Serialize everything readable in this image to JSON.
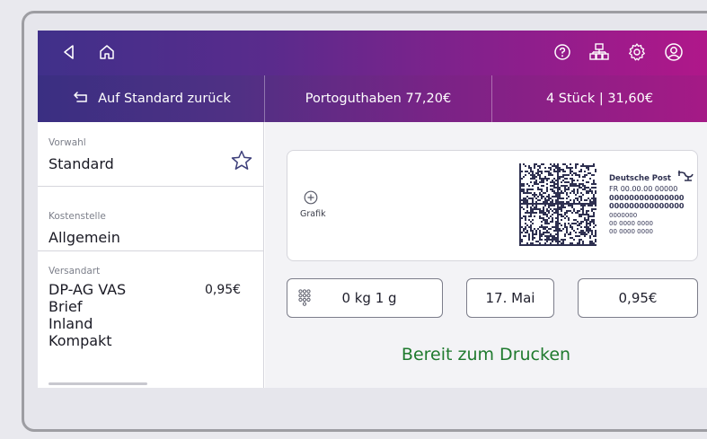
{
  "topbar": {
    "icons": [
      "back-triangle-icon",
      "home-icon",
      "help-icon",
      "network-icon",
      "settings-icon",
      "account-icon"
    ]
  },
  "subbar": {
    "reset_label": "Auf Standard zurück",
    "balance_label": "Portoguthaben 77,20€",
    "count_label": "4 Stück | 31,60€"
  },
  "sidebar": {
    "preset": {
      "label": "Vorwahl",
      "value": "Standard"
    },
    "cost_center": {
      "label": "Kostenstelle",
      "value": "Allgemein"
    },
    "shipping": {
      "label": "Versandart",
      "lines": [
        "DP-AG VAS",
        "Brief",
        "Inland",
        "Kompakt"
      ],
      "price": "0,95€"
    }
  },
  "stamp": {
    "add_graphic_label": "Grafik",
    "brand": "Deutsche Post",
    "country_line": "FR 00.00.00  00000",
    "code_lines": [
      "000000000000000",
      "000000000000000",
      "0000000",
      "00 0000 0000",
      "00 0000 0000"
    ]
  },
  "controls": {
    "weight": "0 kg 1 g",
    "date": "17. Mai",
    "postage": "0,95€"
  },
  "status": {
    "text": "Bereit zum Drucken",
    "color": "#1f7a2e"
  },
  "colors": {
    "bar_left": "#40308a",
    "bar_right": "#b0178a"
  }
}
